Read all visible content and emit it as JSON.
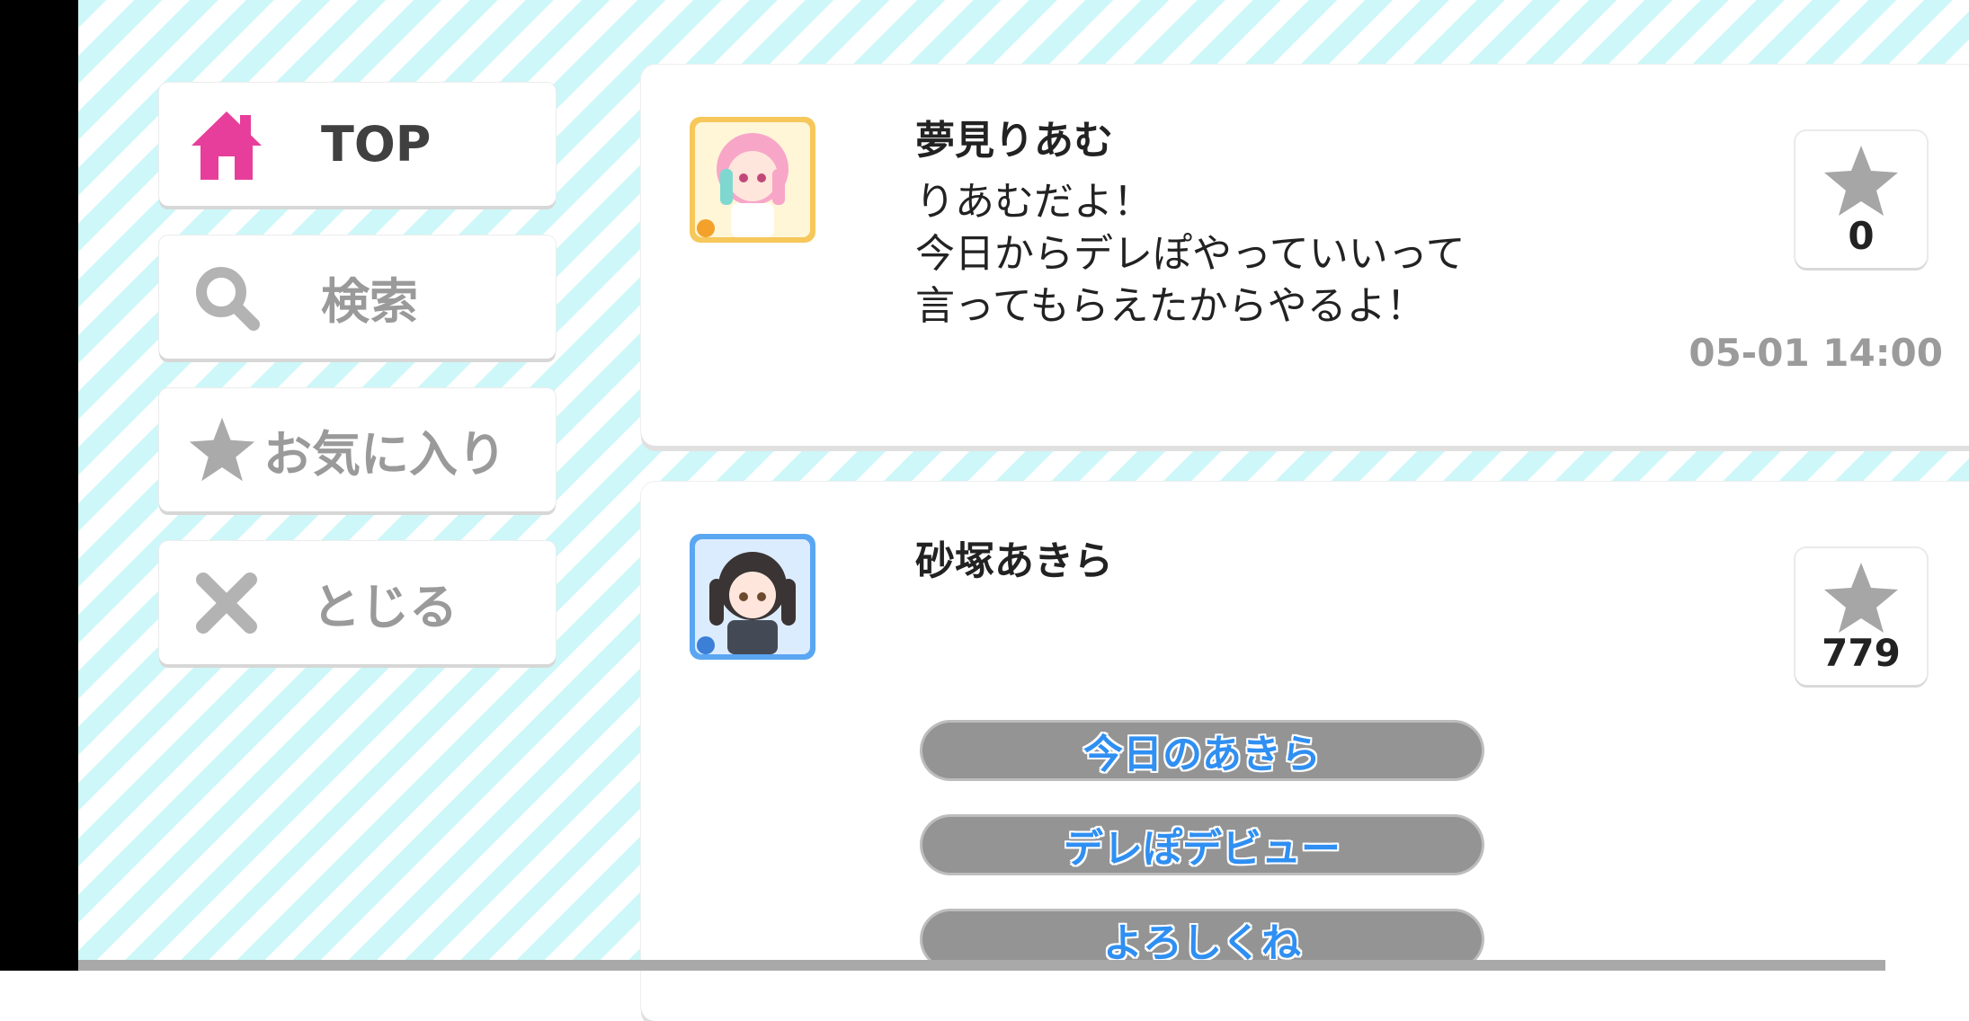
{
  "menu": {
    "top_label": "TOP",
    "search_label": "検索",
    "favorites_label": "お気に入り",
    "close_label": "とじる"
  },
  "icons": {
    "top": "home-icon",
    "search": "search-icon",
    "favorites": "star-icon",
    "close": "close-icon"
  },
  "posts": [
    {
      "name": "夢見りあむ",
      "lines": [
        "りあむだよ！",
        "今日からデレぽやっていいって",
        "言ってもらえたからやるよ！"
      ],
      "fav_count": "0",
      "timestamp": "05-01 14:00"
    },
    {
      "name": "砂塚あきら",
      "fav_count": "779",
      "options": [
        "今日のあきら",
        "デレぽデビュー",
        "よろしくね"
      ]
    }
  ],
  "colors": {
    "stripe": "#cdf7f8",
    "home_icon": "#e83e9b",
    "option_text": "#2f8ff2",
    "option_bg": "#949494",
    "avatar1_frame": "#f6c75a",
    "avatar2_frame": "#5aa6f2"
  }
}
